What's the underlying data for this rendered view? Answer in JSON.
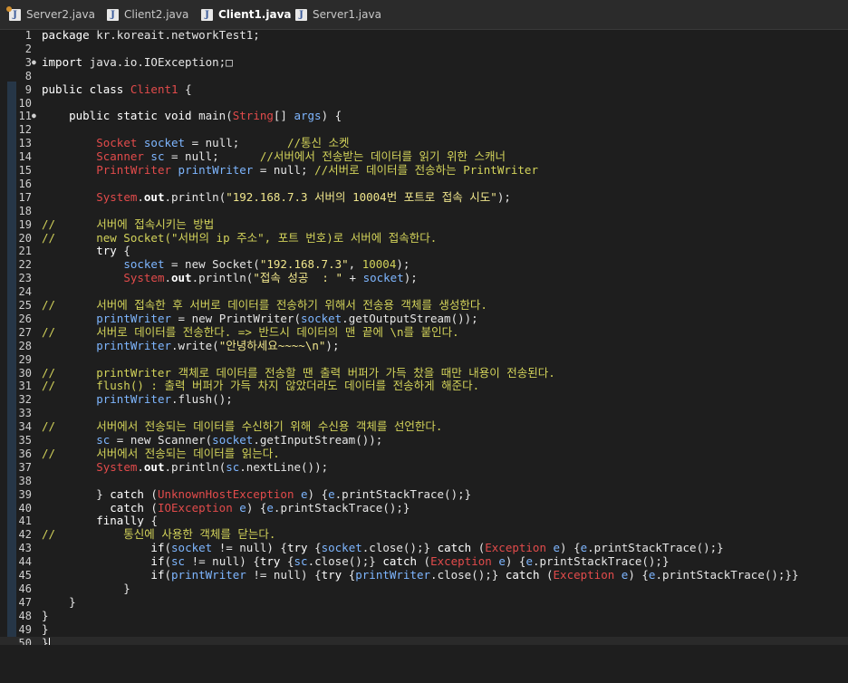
{
  "tabs": [
    {
      "label": "Server2.java",
      "active": false
    },
    {
      "label": "Client2.java",
      "active": false
    },
    {
      "label": "Client1.java",
      "active": true
    },
    {
      "label": "Server1.java",
      "active": false
    }
  ],
  "lines": [
    {
      "n": "1",
      "tokens": [
        [
          "kw",
          "package "
        ],
        [
          "",
          "kr.koreait.networkTest1;"
        ]
      ]
    },
    {
      "n": "2",
      "tokens": []
    },
    {
      "n": "3",
      "mark": "●",
      "tokens": [
        [
          "kw",
          "import "
        ],
        [
          "",
          "java.io.IOException;"
        ],
        [
          "",
          "□"
        ]
      ]
    },
    {
      "n": "8",
      "tokens": []
    },
    {
      "n": "9",
      "tokens": [
        [
          "kw",
          "public class "
        ],
        [
          "tp",
          "Client1 "
        ],
        [
          "",
          "{"
        ]
      ]
    },
    {
      "n": "10",
      "tokens": []
    },
    {
      "n": "11",
      "mark": "●",
      "tokens": [
        [
          "",
          "    "
        ],
        [
          "kw",
          "public static void "
        ],
        [
          "",
          "main("
        ],
        [
          "tp",
          "String"
        ],
        [
          "",
          "[] "
        ],
        [
          "vr",
          "args"
        ],
        [
          "",
          ") {"
        ]
      ]
    },
    {
      "n": "12",
      "tokens": []
    },
    {
      "n": "13",
      "tokens": [
        [
          "",
          "        "
        ],
        [
          "tp",
          "Socket"
        ],
        [
          "",
          ""
        ],
        [
          "vr",
          " socket"
        ],
        [
          "",
          " = null;       "
        ],
        [
          "cm",
          "//통신 소켓"
        ]
      ]
    },
    {
      "n": "14",
      "tokens": [
        [
          "",
          "        "
        ],
        [
          "tp",
          "Scanner"
        ],
        [
          "vr",
          " sc"
        ],
        [
          "",
          " = null;      "
        ],
        [
          "cm",
          "//서버에서 전송받는 데이터를 읽기 위한 스캐너"
        ]
      ]
    },
    {
      "n": "15",
      "tokens": [
        [
          "",
          "        "
        ],
        [
          "tp",
          "PrintWriter"
        ],
        [
          "vr",
          " printWriter"
        ],
        [
          "",
          " = null; "
        ],
        [
          "cm",
          "//서버로 데이터를 전송하는 PrintWriter"
        ]
      ]
    },
    {
      "n": "16",
      "tokens": []
    },
    {
      "n": "17",
      "tokens": [
        [
          "",
          "        "
        ],
        [
          "tp",
          "System"
        ],
        [
          "",
          "."
        ],
        [
          "fd",
          "out"
        ],
        [
          "",
          ".println("
        ],
        [
          "st",
          "\"192.168.7.3 서버의 10004번 포트로 접속 시도\""
        ],
        [
          "",
          ");"
        ]
      ]
    },
    {
      "n": "18",
      "tokens": []
    },
    {
      "n": "19",
      "tokens": [
        [
          "cm",
          "//      서버에 접속시키는 방법"
        ]
      ]
    },
    {
      "n": "20",
      "tokens": [
        [
          "cm",
          "//      new Socket(\"서버의 ip 주소\", 포트 번호)로 서버에 접속한다."
        ]
      ]
    },
    {
      "n": "21",
      "tokens": [
        [
          "",
          "        "
        ],
        [
          "kw",
          "try "
        ],
        [
          "",
          "{"
        ]
      ]
    },
    {
      "n": "22",
      "tokens": [
        [
          "",
          "            "
        ],
        [
          "vr",
          "socket"
        ],
        [
          "",
          " = new Socket("
        ],
        [
          "st",
          "\"192.168.7.3\""
        ],
        [
          "",
          ", "
        ],
        [
          "nm",
          "10004"
        ],
        [
          "",
          ");"
        ]
      ]
    },
    {
      "n": "23",
      "tokens": [
        [
          "",
          "            "
        ],
        [
          "tp",
          "System"
        ],
        [
          "",
          "."
        ],
        [
          "fd",
          "out"
        ],
        [
          "",
          ".println("
        ],
        [
          "st",
          "\"접속 성공  : \""
        ],
        [
          "",
          " + "
        ],
        [
          "vr",
          "socket"
        ],
        [
          "",
          ");"
        ]
      ]
    },
    {
      "n": "24",
      "tokens": []
    },
    {
      "n": "25",
      "tokens": [
        [
          "cm",
          "//      서버에 접속한 후 서버로 데이터를 전송하기 위해서 전송용 객체를 생성한다."
        ]
      ]
    },
    {
      "n": "26",
      "tokens": [
        [
          "",
          "        "
        ],
        [
          "vr",
          "printWriter"
        ],
        [
          "",
          " = new PrintWriter("
        ],
        [
          "vr",
          "socket"
        ],
        [
          "",
          ".getOutputStream());"
        ]
      ]
    },
    {
      "n": "27",
      "tokens": [
        [
          "cm",
          "//      서버로 데이터를 전송한다. => 반드시 데이터의 맨 끝에 \\n를 붙인다."
        ]
      ]
    },
    {
      "n": "28",
      "tokens": [
        [
          "",
          "        "
        ],
        [
          "vr",
          "printWriter"
        ],
        [
          "",
          ".write("
        ],
        [
          "st",
          "\"안녕하세요~~~~\\n\""
        ],
        [
          "",
          ");"
        ]
      ]
    },
    {
      "n": "29",
      "tokens": []
    },
    {
      "n": "30",
      "tokens": [
        [
          "cm",
          "//      printWriter 객체로 데이터를 전송할 땐 출력 버퍼가 가득 찼을 때만 내용이 전송된다."
        ]
      ]
    },
    {
      "n": "31",
      "tokens": [
        [
          "cm",
          "//      flush() : 출력 버퍼가 가득 차지 않았더라도 데이터를 전송하게 해준다."
        ]
      ]
    },
    {
      "n": "32",
      "tokens": [
        [
          "",
          "        "
        ],
        [
          "vr",
          "printWriter"
        ],
        [
          "",
          ".flush();"
        ]
      ]
    },
    {
      "n": "33",
      "tokens": []
    },
    {
      "n": "34",
      "tokens": [
        [
          "cm",
          "//      서버에서 전송되는 데이터를 수신하기 위해 수신용 객체를 선언한다."
        ]
      ]
    },
    {
      "n": "35",
      "tokens": [
        [
          "",
          "        "
        ],
        [
          "vr",
          "sc"
        ],
        [
          "",
          " = new Scanner("
        ],
        [
          "vr",
          "socket"
        ],
        [
          "",
          ".getInputStream());"
        ]
      ]
    },
    {
      "n": "36",
      "tokens": [
        [
          "cm",
          "//      서버에서 전송되는 데이터를 읽는다."
        ]
      ]
    },
    {
      "n": "37",
      "tokens": [
        [
          "",
          "        "
        ],
        [
          "tp",
          "System"
        ],
        [
          "",
          "."
        ],
        [
          "fd",
          "out"
        ],
        [
          "",
          ".println("
        ],
        [
          "vr",
          "sc"
        ],
        [
          "",
          ".nextLine());"
        ]
      ]
    },
    {
      "n": "38",
      "tokens": []
    },
    {
      "n": "39",
      "tokens": [
        [
          "",
          "        } "
        ],
        [
          "kw",
          "catch "
        ],
        [
          "",
          "("
        ],
        [
          "tp",
          "UnknownHostException"
        ],
        [
          "vr",
          " e"
        ],
        [
          "",
          ") {"
        ],
        [
          "vr",
          "e"
        ],
        [
          "",
          ".printStackTrace();}"
        ]
      ]
    },
    {
      "n": "40",
      "tokens": [
        [
          "",
          "          "
        ],
        [
          "kw",
          "catch "
        ],
        [
          "",
          "("
        ],
        [
          "tp",
          "IOException"
        ],
        [
          "vr",
          " e"
        ],
        [
          "",
          ") {"
        ],
        [
          "vr",
          "e"
        ],
        [
          "",
          ".printStackTrace();}"
        ]
      ]
    },
    {
      "n": "41",
      "tokens": [
        [
          "",
          "        "
        ],
        [
          "kw",
          "finally "
        ],
        [
          "",
          "{"
        ]
      ]
    },
    {
      "n": "42",
      "tokens": [
        [
          "cm",
          "//          통신에 사용한 객체를 닫는다."
        ]
      ]
    },
    {
      "n": "43",
      "tokens": [
        [
          "",
          "                "
        ],
        [
          "kw",
          "if"
        ],
        [
          "",
          "("
        ],
        [
          "vr",
          "socket"
        ],
        [
          "",
          " != null) {"
        ],
        [
          "kw",
          "try "
        ],
        [
          "",
          "{"
        ],
        [
          "vr",
          "socket"
        ],
        [
          "",
          ".close();} "
        ],
        [
          "kw",
          "catch "
        ],
        [
          "",
          "("
        ],
        [
          "tp",
          "Exception"
        ],
        [
          "vr",
          " e"
        ],
        [
          "",
          ") {"
        ],
        [
          "vr",
          "e"
        ],
        [
          "",
          ".printStackTrace();}"
        ]
      ]
    },
    {
      "n": "44",
      "tokens": [
        [
          "",
          "                "
        ],
        [
          "kw",
          "if"
        ],
        [
          "",
          "("
        ],
        [
          "vr",
          "sc"
        ],
        [
          "",
          " != null) {"
        ],
        [
          "kw",
          "try "
        ],
        [
          "",
          "{"
        ],
        [
          "vr",
          "sc"
        ],
        [
          "",
          ".close();} "
        ],
        [
          "kw",
          "catch "
        ],
        [
          "",
          "("
        ],
        [
          "tp",
          "Exception"
        ],
        [
          "vr",
          " e"
        ],
        [
          "",
          ") {"
        ],
        [
          "vr",
          "e"
        ],
        [
          "",
          ".printStackTrace();}"
        ]
      ]
    },
    {
      "n": "45",
      "tokens": [
        [
          "",
          "                "
        ],
        [
          "kw",
          "if"
        ],
        [
          "",
          "("
        ],
        [
          "vr",
          "printWriter"
        ],
        [
          "",
          " != null) {"
        ],
        [
          "kw",
          "try "
        ],
        [
          "",
          "{"
        ],
        [
          "vr",
          "printWriter"
        ],
        [
          "",
          ".close();} "
        ],
        [
          "kw",
          "catch "
        ],
        [
          "",
          "("
        ],
        [
          "tp",
          "Exception"
        ],
        [
          "vr",
          " e"
        ],
        [
          "",
          ") {"
        ],
        [
          "vr",
          "e"
        ],
        [
          "",
          ".printStackTrace();}}"
        ]
      ]
    },
    {
      "n": "46",
      "tokens": [
        [
          "",
          "            }"
        ]
      ]
    },
    {
      "n": "47",
      "tokens": [
        [
          "",
          "    }"
        ]
      ]
    },
    {
      "n": "48",
      "tokens": [
        [
          "",
          "}"
        ]
      ]
    },
    {
      "n": "49",
      "tokens": [
        [
          "",
          "}"
        ]
      ]
    },
    {
      "n": "50",
      "current": true,
      "tokens": [
        [
          "",
          "}"
        ]
      ]
    }
  ]
}
